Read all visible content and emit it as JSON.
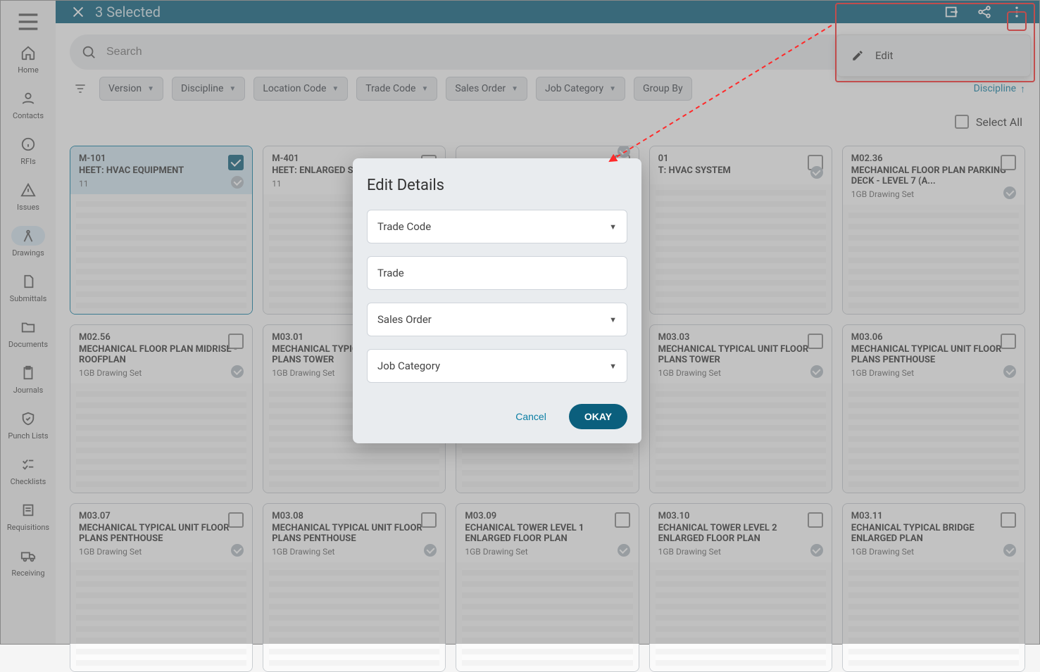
{
  "topbar": {
    "title": "3 Selected"
  },
  "sidebar": {
    "items": [
      {
        "label": "Home"
      },
      {
        "label": "Contacts"
      },
      {
        "label": "RFIs"
      },
      {
        "label": "Issues"
      },
      {
        "label": "Drawings"
      },
      {
        "label": "Submittals"
      },
      {
        "label": "Documents"
      },
      {
        "label": "Journals"
      },
      {
        "label": "Punch Lists"
      },
      {
        "label": "Checklists"
      },
      {
        "label": "Requisitions"
      },
      {
        "label": "Receiving"
      }
    ]
  },
  "search": {
    "placeholder": "Search"
  },
  "filters": {
    "chips": [
      "Version",
      "Discipline",
      "Location Code",
      "Trade Code",
      "Sales Order",
      "Job Category",
      "Group By"
    ],
    "sort": "Discipline"
  },
  "selectAll": "Select All",
  "popover": {
    "edit": "Edit"
  },
  "modal": {
    "title": "Edit Details",
    "tradeCode": "Trade Code",
    "trade": "Trade",
    "salesOrder": "Sales Order",
    "jobCategory": "Job Category",
    "cancel": "Cancel",
    "ok": "OKAY"
  },
  "cards": [
    {
      "code": "M-101",
      "title": "HEET: HVAC EQUIPMENT",
      "sub": "11",
      "checked": true
    },
    {
      "code": "M-401",
      "title": "HEET: ENLARGED SECTION",
      "sub": "11",
      "checked": false
    },
    {
      "code": "",
      "title": "",
      "sub": "",
      "checked": false
    },
    {
      "code": "01",
      "title": "T: HVAC SYSTEM",
      "sub": "",
      "checked": false
    },
    {
      "code": "M02.36",
      "title": "MECHANICAL FLOOR PLAN PARKING DECK - LEVEL 7 (A...",
      "sub": "1GB Drawing Set",
      "checked": false
    },
    {
      "code": "M02.56",
      "title": "MECHANICAL FLOOR PLAN MIDRISE - ROOFPLAN",
      "sub": "1GB Drawing Set",
      "checked": false
    },
    {
      "code": "M03.01",
      "title": "MECHANICAL TYPICAL UNIT FLOOR PLANS TOWER",
      "sub": "1GB Drawing Set",
      "checked": false
    },
    {
      "code": "",
      "title": "",
      "sub": "",
      "checked": false
    },
    {
      "code": "M03.03",
      "title": "MECHANICAL TYPICAL UNIT FLOOR PLANS TOWER",
      "sub": "1GB Drawing Set",
      "checked": false
    },
    {
      "code": "M03.06",
      "title": "MECHANICAL TYPICAL UNIT FLOOR PLANS PENTHOUSE",
      "sub": "1GB Drawing Set",
      "checked": false
    },
    {
      "code": "M03.07",
      "title": "MECHANICAL TYPICAL UNIT FLOOR PLANS PENTHOUSE",
      "sub": "1GB Drawing Set",
      "checked": false
    },
    {
      "code": "M03.08",
      "title": "MECHANICAL TYPICAL UNIT FLOOR PLANS PENTHOUSE",
      "sub": "1GB Drawing Set",
      "checked": false
    },
    {
      "code": "M03.09",
      "title": "ECHANICAL TOWER LEVEL 1 ENLARGED FLOOR PLAN",
      "sub": "1GB Drawing Set",
      "checked": false
    },
    {
      "code": "M03.10",
      "title": "ECHANICAL TOWER LEVEL 2 ENLARGED FLOOR PLAN",
      "sub": "1GB Drawing Set",
      "checked": false
    },
    {
      "code": "M03.11",
      "title": "ECHANICAL TYPICAL BRIDGE ENLARGED PLAN",
      "sub": "1GB Drawing Set",
      "checked": false
    }
  ]
}
